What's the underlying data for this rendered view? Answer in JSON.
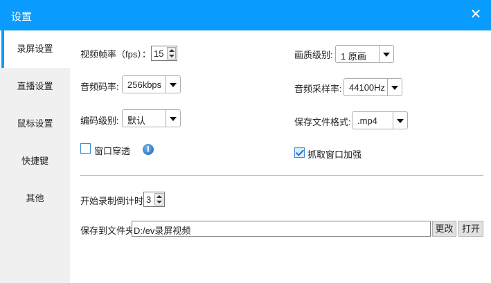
{
  "window": {
    "title": "设置",
    "close_icon": "close-icon"
  },
  "sidebar": {
    "items": [
      {
        "label": "录屏设置",
        "active": true
      },
      {
        "label": "直播设置"
      },
      {
        "label": "鼠标设置"
      },
      {
        "label": "快捷键"
      },
      {
        "label": "其他"
      }
    ]
  },
  "colors": {
    "accent": "#0a9bff"
  },
  "form": {
    "fps": {
      "label": "视频帧率（fps）：",
      "value": "15"
    },
    "bitrate": {
      "label": "音频码率:",
      "value": "256kbps"
    },
    "encode": {
      "label": "编码级别:",
      "value": "默认"
    },
    "passthrough": {
      "label": "窗口穿透",
      "checked": false
    },
    "quality": {
      "label": "画质级别:",
      "value": "1 原画"
    },
    "samplerate": {
      "label": "音频采样率:",
      "value": "44100Hz"
    },
    "format": {
      "label": "保存文件格式:",
      "value": ".mp4"
    },
    "capture_enhance": {
      "label": "抓取窗口加强",
      "checked": true
    },
    "countdown": {
      "label": "开始录制倒计时:",
      "value": "3"
    },
    "folder": {
      "label": "保存到文件夹:",
      "value": "D:/ev录屏视频",
      "change": "更改",
      "open": "打开"
    }
  }
}
